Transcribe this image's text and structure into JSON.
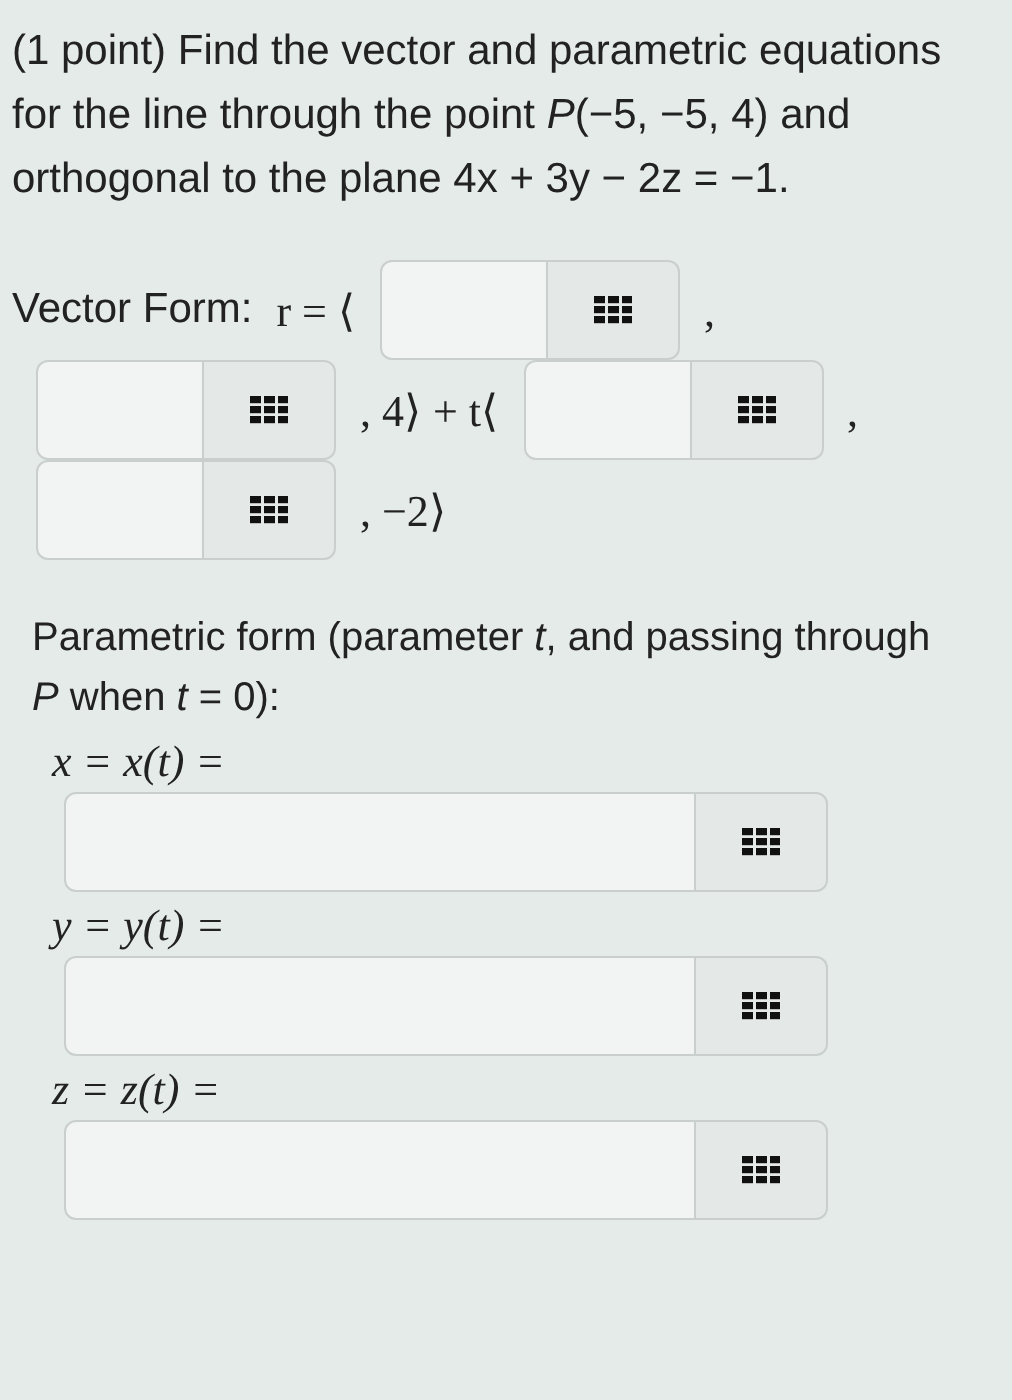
{
  "problem": {
    "statement": "(1 point) Find the vector and parametric equations for the line through the point *P*(−5, −5, 4) and orthogonal to the plane 4x + 3y − 2z = −1."
  },
  "vector_form": {
    "rows": [
      [
        {
          "kind": "label",
          "text": "Vector Form:"
        },
        {
          "kind": "math",
          "text": "r = ⟨"
        },
        {
          "kind": "field"
        },
        {
          "kind": "math",
          "text": ","
        }
      ],
      [
        {
          "kind": "field"
        },
        {
          "kind": "math",
          "text": ", 4⟩ + t⟨"
        },
        {
          "kind": "field"
        },
        {
          "kind": "math",
          "text": ","
        }
      ],
      [
        {
          "kind": "field"
        },
        {
          "kind": "math",
          "text": ", −2⟩"
        }
      ]
    ]
  },
  "parametric_form": {
    "intro": "Parametric form (parameter *t*, and passing through *P* when *t* = 0):",
    "equations": [
      {
        "label": "x = x(t) ="
      },
      {
        "label": "y = y(t) ="
      },
      {
        "label": "z = z(t) ="
      }
    ]
  }
}
